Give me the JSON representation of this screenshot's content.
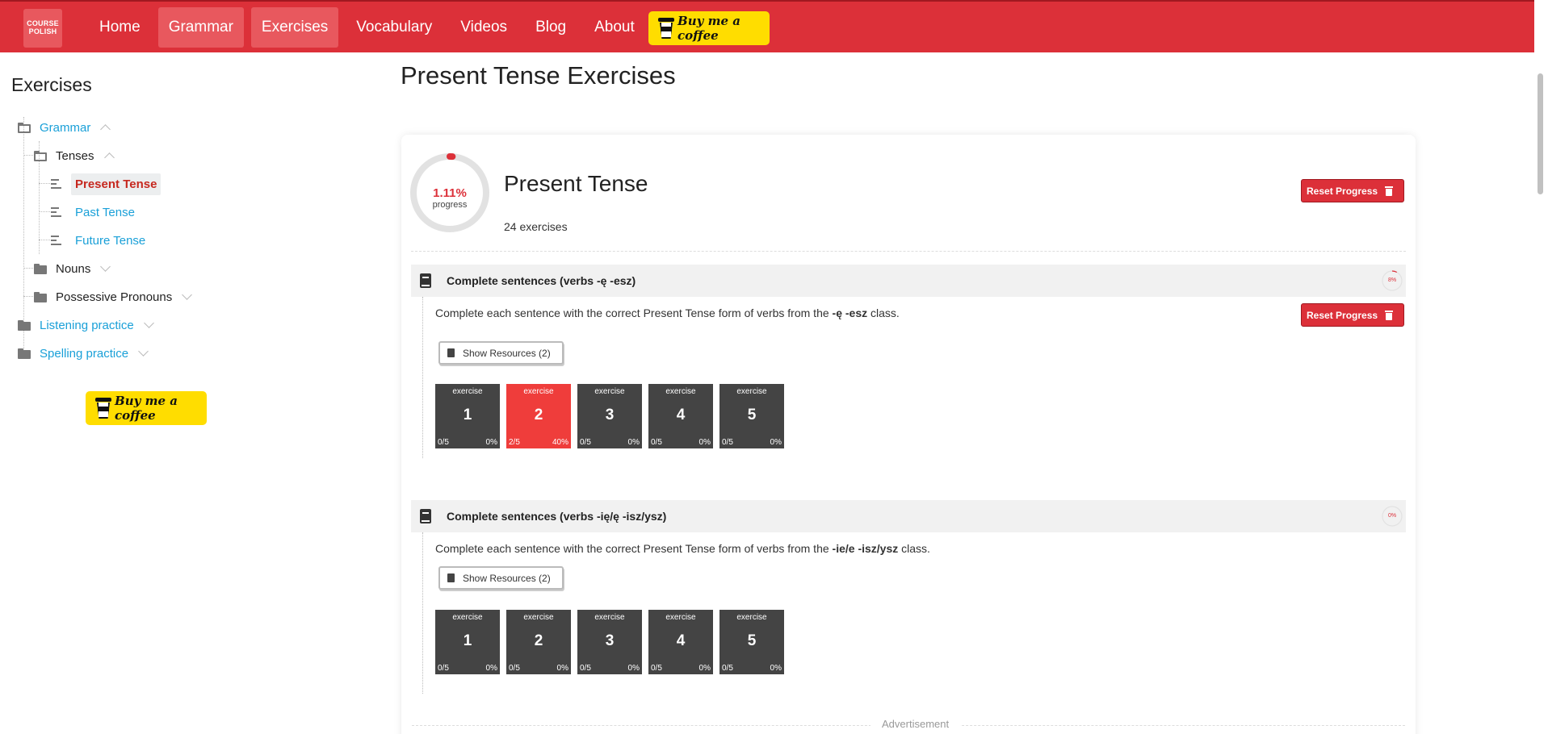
{
  "nav": {
    "logo": "COURSE POLISH",
    "items": [
      {
        "label": "Home",
        "active": false
      },
      {
        "label": "Grammar",
        "active": true
      },
      {
        "label": "Exercises",
        "active": true
      },
      {
        "label": "Vocabulary",
        "active": false
      },
      {
        "label": "Videos",
        "active": false
      },
      {
        "label": "Blog",
        "active": false
      },
      {
        "label": "About",
        "active": false
      }
    ],
    "coffee_label": "Buy me a coffee"
  },
  "sidebar": {
    "title": "Exercises",
    "tree": {
      "grammar": "Grammar",
      "tenses": "Tenses",
      "present": "Present Tense",
      "past": "Past Tense",
      "future": "Future Tense",
      "nouns": "Nouns",
      "possessive": "Possessive Pronouns",
      "listening": "Listening practice",
      "spelling": "Spelling practice"
    },
    "coffee_label": "Buy me a coffee"
  },
  "main": {
    "page_title": "Present Tense Exercises",
    "card": {
      "progress_pct": "1.11%",
      "progress_value": 1.11,
      "progress_label": "progress",
      "title": "Present Tense",
      "count": "24 exercises",
      "reset_label": "Reset Progress"
    },
    "sections": [
      {
        "title": "Complete sentences (verbs -ę -esz)",
        "mini_pct": "8%",
        "mini_value": 8,
        "desc_prefix": "Complete each sentence with the correct Present Tense form of verbs from the",
        "desc_bold": "-ę -esz",
        "desc_suffix": "class.",
        "reset_label": "Reset Progress",
        "resources_label": "Show Resources (2)",
        "exercises": [
          {
            "label": "exercise",
            "num": "1",
            "score": "0/5",
            "pct": "0%"
          },
          {
            "label": "exercise",
            "num": "2",
            "score": "2/5",
            "pct": "40%"
          },
          {
            "label": "exercise",
            "num": "3",
            "score": "0/5",
            "pct": "0%"
          },
          {
            "label": "exercise",
            "num": "4",
            "score": "0/5",
            "pct": "0%"
          },
          {
            "label": "exercise",
            "num": "5",
            "score": "0/5",
            "pct": "0%"
          }
        ]
      },
      {
        "title": "Complete sentences (verbs -ię/ę -isz/ysz)",
        "mini_pct": "0%",
        "mini_value": 0,
        "desc_prefix": "Complete each sentence with the correct Present Tense form of verbs from the",
        "desc_bold": "-ie/e -isz/ysz",
        "desc_suffix": "class.",
        "resources_label": "Show Resources (2)",
        "exercises": [
          {
            "label": "exercise",
            "num": "1",
            "score": "0/5",
            "pct": "0%"
          },
          {
            "label": "exercise",
            "num": "2",
            "score": "0/5",
            "pct": "0%"
          },
          {
            "label": "exercise",
            "num": "3",
            "score": "0/5",
            "pct": "0%"
          },
          {
            "label": "exercise",
            "num": "4",
            "score": "0/5",
            "pct": "0%"
          },
          {
            "label": "exercise",
            "num": "5",
            "score": "0/5",
            "pct": "0%"
          }
        ]
      }
    ],
    "ad_label": "Advertisement"
  },
  "colors": {
    "brand_red": "#dc3039",
    "link_blue": "#1aa0d8",
    "coffee_yellow": "#ffdd00",
    "tile_dark": "#444444",
    "tile_active": "#ef3d3b"
  }
}
